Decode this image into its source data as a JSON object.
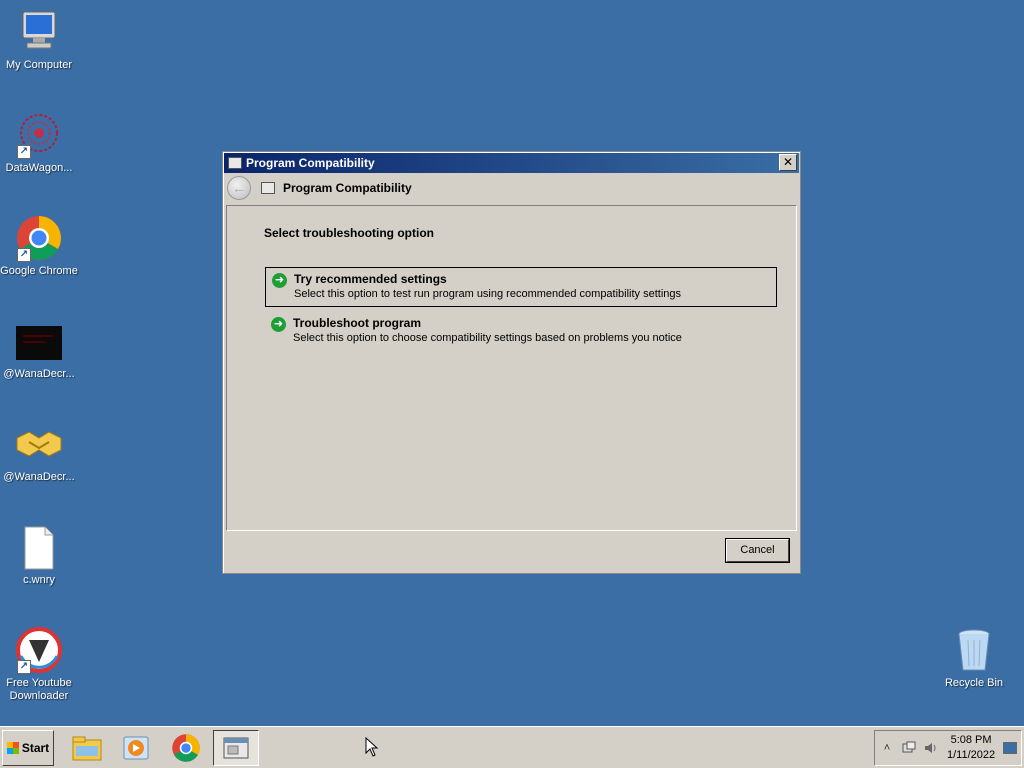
{
  "desktop": {
    "icons": [
      {
        "label": "My Computer",
        "icon": "computer-icon"
      },
      {
        "label": "DataWagon...",
        "icon": "datawagon-icon",
        "shortcut": true
      },
      {
        "label": "Google Chrome",
        "icon": "chrome-icon",
        "shortcut": true
      },
      {
        "label": "@WanaDecr...",
        "icon": "wanadecryptor-icon"
      },
      {
        "label": "@WanaDecr...",
        "icon": "handshake-icon"
      },
      {
        "label": "c.wnry",
        "icon": "file-icon"
      },
      {
        "label": "Free Youtube Downloader",
        "icon": "youtube-downloader-icon",
        "shortcut": true
      },
      {
        "label": "Recycle Bin",
        "icon": "recycle-bin-icon"
      }
    ]
  },
  "dialog": {
    "title": "Program Compatibility",
    "nav_title": "Program Compatibility",
    "close_glyph": "✕",
    "back_glyph": "←",
    "section_title": "Select troubleshooting option",
    "options": [
      {
        "title": "Try recommended settings",
        "description": "Select this option to test run program using recommended compatibility settings",
        "selected": true
      },
      {
        "title": "Troubleshoot program",
        "description": "Select this option to choose compatibility settings based on problems you notice",
        "selected": false
      }
    ],
    "cancel_label": "Cancel"
  },
  "taskbar": {
    "start_label": "Start",
    "pinned": [
      "explorer-icon",
      "media-player-icon",
      "chrome-icon",
      "program-compatibility-icon"
    ],
    "tray": {
      "time": "5:08 PM",
      "date": "1/11/2022",
      "expand_glyph": "˄"
    }
  },
  "colors": {
    "desktop": "#3b6ea5",
    "titlebar_start": "#0a246a",
    "titlebar_end": "#3a6ea5",
    "dialog_bg": "#d4d0c8",
    "arrow_green": "#1e9e36"
  }
}
